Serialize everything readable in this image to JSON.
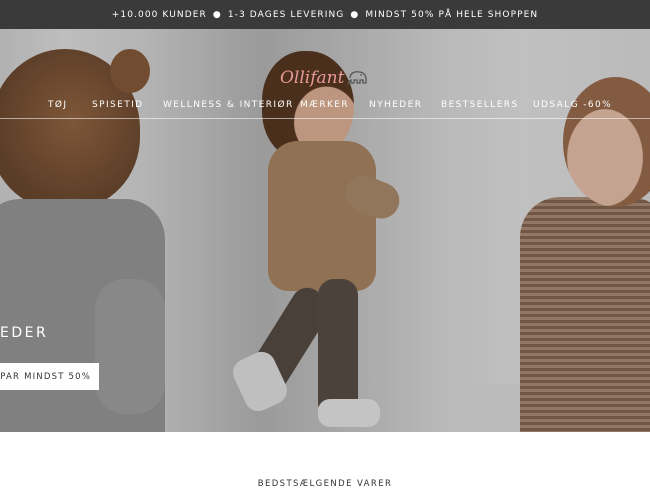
{
  "announcement": {
    "items": [
      "+10.000 KUNDER",
      "1-3 DAGES LEVERING",
      "MINDST 50% PÅ HELE SHOPPEN"
    ],
    "separator": "●"
  },
  "logo": {
    "text": "Ollifant",
    "icon": "elephant-icon"
  },
  "nav": {
    "items": [
      {
        "label": "TØJ"
      },
      {
        "label": "SPISETID"
      },
      {
        "label": "WELLNESS & INTERIØR"
      },
      {
        "label": "MÆRKER"
      },
      {
        "label": "NYHEDER"
      },
      {
        "label": "BESTSELLERS"
      },
      {
        "label": "UDSALG -60%"
      }
    ]
  },
  "hero": {
    "title": "EDER",
    "cta_label": "PAR MINDST 50%"
  },
  "section": {
    "title": "BEDSTSÆLGENDE VARER"
  },
  "colors": {
    "announcement_bg": "#3a3a3a",
    "logo": "#e79a9a",
    "cta_bg": "#ffffff"
  }
}
